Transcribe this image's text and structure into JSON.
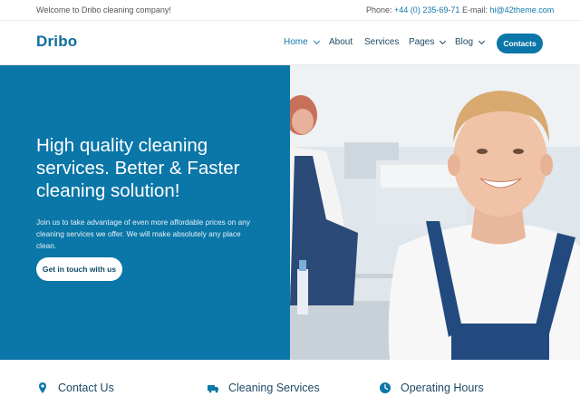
{
  "topbar": {
    "welcome": "Welcome to Dribo cleaning company!",
    "phone_label": "Phone:",
    "phone_value": "+44 (0) 235-69-71",
    "email_label": "E-mail:",
    "email_value": "hi@42theme.com"
  },
  "header": {
    "logo": "Dribo",
    "nav": [
      {
        "label": "Home"
      },
      {
        "label": "About"
      },
      {
        "label": "Services"
      },
      {
        "label": "Pages"
      },
      {
        "label": "Blog"
      }
    ],
    "contacts_label": "Contacts"
  },
  "hero": {
    "title": "High quality cleaning services. Better & Faster cleaning solution!",
    "text": "Join us to take advantage of even more affordable prices on any cleaning services we offer. We will make absolutely any place clean.",
    "button_label": "Get in touch with us"
  },
  "features": [
    {
      "label": "Contact Us",
      "icon": "location-pin-icon"
    },
    {
      "label": "Cleaning Services",
      "icon": "truck-icon"
    },
    {
      "label": "Operating Hours",
      "icon": "clock-icon"
    }
  ],
  "colors": {
    "brand": "#0b76a8",
    "accent": "#1179ac",
    "nav_text": "#1d4a66"
  }
}
